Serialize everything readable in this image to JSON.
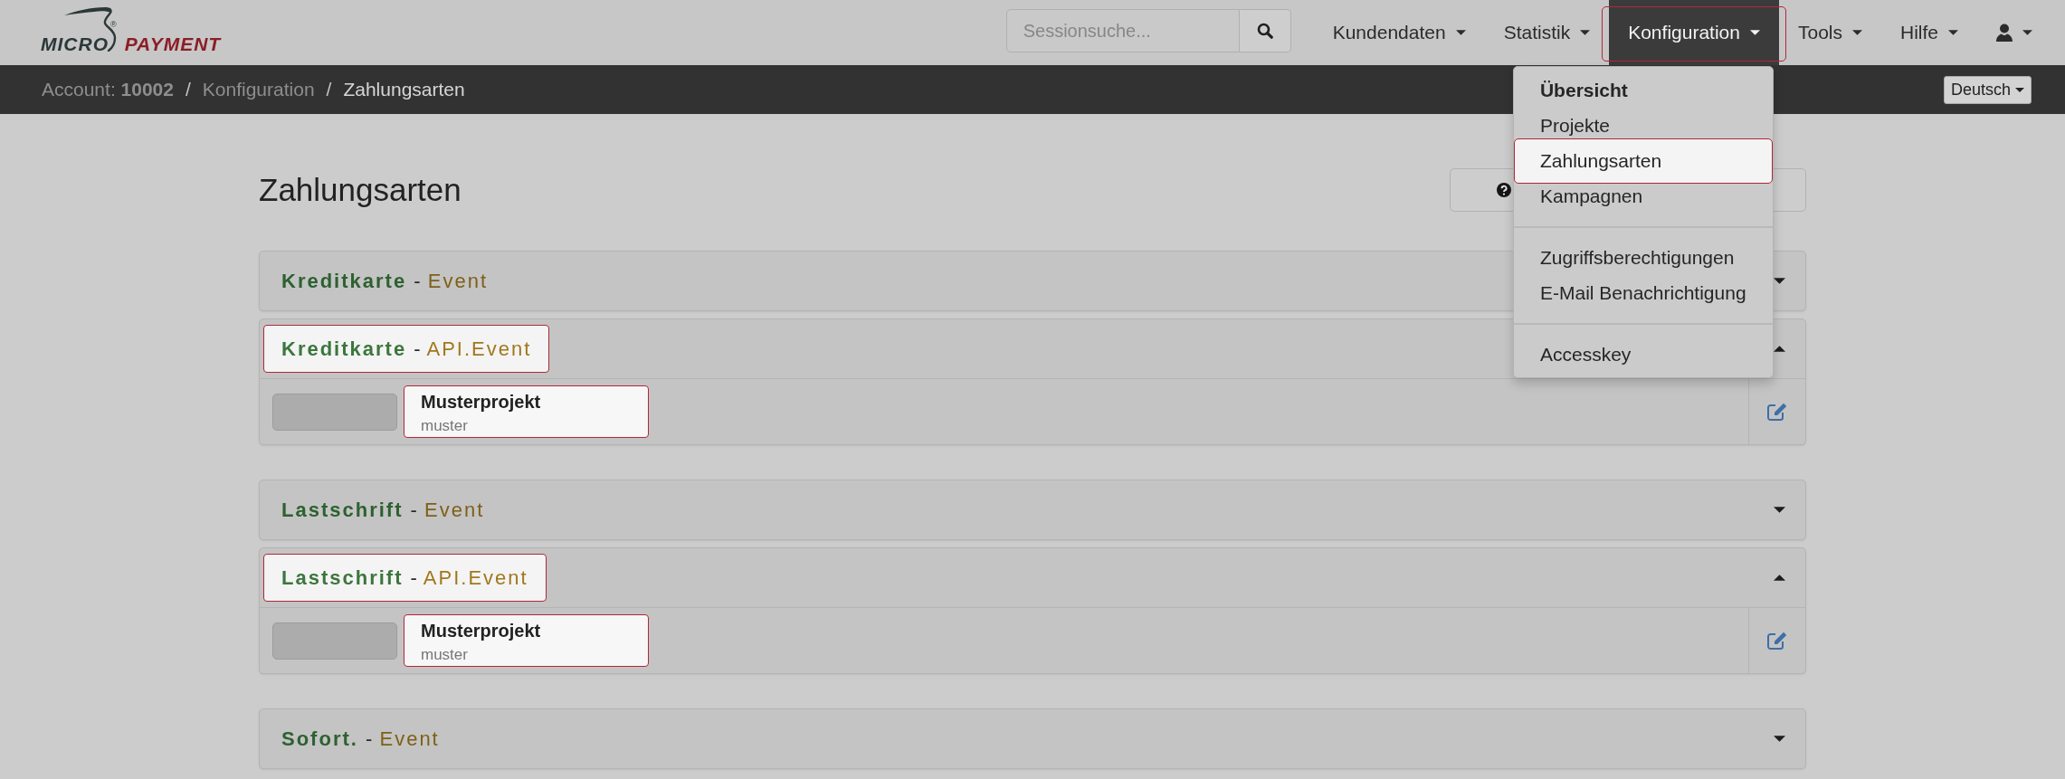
{
  "navbar": {
    "logo": {
      "word_1": "MICRO",
      "mark": "®",
      "word_2": "PAYMENT"
    },
    "search": {
      "placeholder": "Sessionsuche..."
    },
    "menu": [
      {
        "kind": "text",
        "label": "Kundendaten",
        "selected": false,
        "highlighted": false
      },
      {
        "kind": "text",
        "label": "Statistik",
        "selected": false,
        "highlighted": false
      },
      {
        "kind": "text",
        "label": "Konfiguration",
        "selected": true,
        "highlighted": true,
        "dropdown": [
          {
            "items": [
              {
                "kind": "header",
                "label": "Übersicht",
                "highlighted": false
              },
              {
                "kind": "link",
                "label": "Projekte",
                "highlighted": false
              },
              {
                "kind": "link",
                "label": "Zahlungsarten",
                "highlighted": true
              },
              {
                "kind": "link",
                "label": "Kampagnen",
                "highlighted": false
              }
            ]
          },
          {
            "items": [
              {
                "kind": "link",
                "label": "Zugriffsberechtigungen",
                "highlighted": false
              },
              {
                "kind": "link",
                "label": "E-Mail Benachrichtigung",
                "highlighted": false
              }
            ]
          },
          {
            "items": [
              {
                "kind": "link",
                "label": "Accesskey",
                "highlighted": false
              }
            ]
          }
        ]
      },
      {
        "kind": "text",
        "label": "Tools",
        "selected": false,
        "highlighted": false
      },
      {
        "kind": "text",
        "label": "Hilfe",
        "selected": false,
        "highlighted": false
      },
      {
        "kind": "user",
        "selected": false,
        "highlighted": false
      }
    ]
  },
  "breadcrumb": {
    "items": [
      {
        "label": "Account: **10002**",
        "current": false
      },
      {
        "label": "Konfiguration",
        "current": false
      },
      {
        "label": "Zahlungsarten",
        "current": true
      }
    ],
    "separators": [
      "/",
      "/"
    ]
  },
  "language": {
    "label": "Deutsch"
  },
  "page": {
    "title": "Zahlungsarten"
  },
  "payment_groups": [
    {
      "panels": [
        {
          "name": "Kreditkarte",
          "separator": "-",
          "type": "Event",
          "expanded": false,
          "highlighted": false
        },
        {
          "name": "Kreditkarte",
          "separator": "-",
          "type": "API.Event",
          "expanded": true,
          "highlighted": true,
          "rows": [
            {
              "project": "Musterprojekt",
              "key": "muster",
              "highlighted": true
            }
          ]
        }
      ]
    },
    {
      "panels": [
        {
          "name": "Lastschrift",
          "separator": "-",
          "type": "Event",
          "expanded": false,
          "highlighted": false
        },
        {
          "name": "Lastschrift",
          "separator": "-",
          "type": "API.Event",
          "expanded": true,
          "highlighted": true,
          "rows": [
            {
              "project": "Musterprojekt",
              "key": "muster",
              "highlighted": true
            }
          ]
        }
      ]
    },
    {
      "panels": [
        {
          "name": "Sofort.",
          "separator": "-",
          "type": "Event",
          "expanded": false,
          "highlighted": false
        }
      ]
    }
  ]
}
